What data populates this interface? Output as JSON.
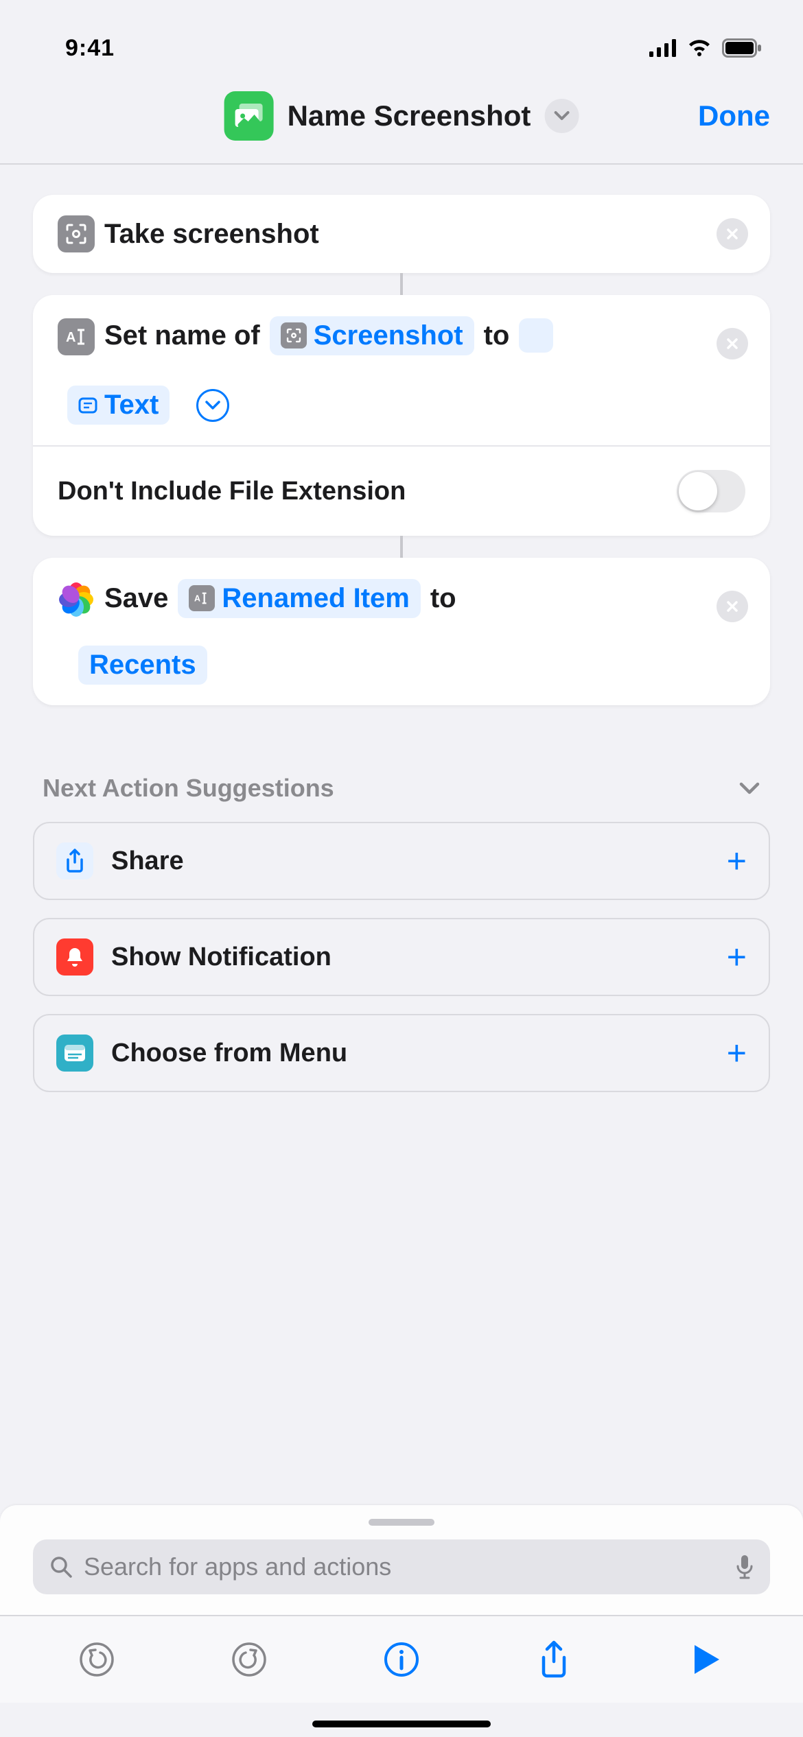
{
  "status": {
    "time": "9:41"
  },
  "header": {
    "title": "Name Screenshot",
    "done": "Done"
  },
  "actions": {
    "a1": {
      "label": "Take screenshot"
    },
    "a2": {
      "prefix": "Set name of",
      "var1": "Screenshot",
      "mid": "to",
      "var2": "Text",
      "option_label": "Don't Include File Extension"
    },
    "a3": {
      "prefix": "Save",
      "var1": "Renamed Item",
      "mid": "to",
      "dest": "Recents"
    }
  },
  "suggestions": {
    "title": "Next Action Suggestions",
    "items": [
      "Share",
      "Show Notification",
      "Choose from Menu"
    ]
  },
  "search": {
    "placeholder": "Search for apps and actions"
  }
}
